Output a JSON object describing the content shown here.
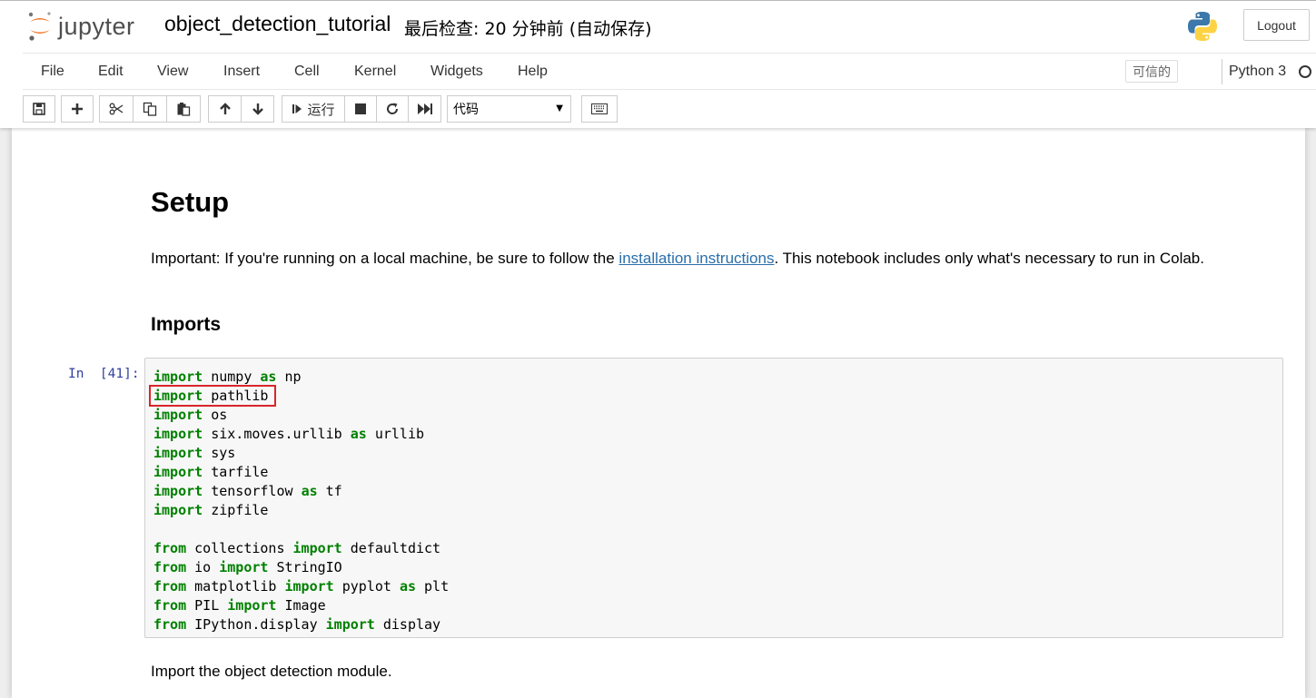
{
  "header": {
    "logo_text": "jupyter",
    "notebook_name": "object_detection_tutorial",
    "save_status": "最后检查: 20 分钟前  (自动保存)",
    "logout_label": "Logout"
  },
  "menu": {
    "items": [
      "File",
      "Edit",
      "View",
      "Insert",
      "Cell",
      "Kernel",
      "Widgets",
      "Help"
    ],
    "trusted_label": "可信的",
    "kernel_name": "Python 3"
  },
  "toolbar": {
    "run_label": "运行",
    "cell_type": "代码",
    "icons": [
      "save-icon",
      "plus-icon",
      "cut-icon",
      "copy-icon",
      "paste-icon",
      "arrow-up-icon",
      "arrow-down-icon",
      "run-icon",
      "stop-icon",
      "restart-icon",
      "fast-forward-icon",
      "keyboard-icon"
    ]
  },
  "notebook": {
    "heading_setup": "Setup",
    "important_text_before": "Important: If you're running on a local machine, be sure to follow the ",
    "important_link": "installation instructions",
    "important_text_after": ". This notebook includes only what's necessary to run in Colab.",
    "heading_imports": "Imports",
    "prompt": "In  [41]:",
    "code_lines": [
      [
        {
          "k": "import"
        },
        {
          "t": " numpy "
        },
        {
          "k": "as"
        },
        {
          "t": " np"
        }
      ],
      [
        {
          "k": "import"
        },
        {
          "t": " pathlib"
        }
      ],
      [
        {
          "k": "import"
        },
        {
          "t": " os"
        }
      ],
      [
        {
          "k": "import"
        },
        {
          "t": " six.moves.urllib "
        },
        {
          "k": "as"
        },
        {
          "t": " urllib"
        }
      ],
      [
        {
          "k": "import"
        },
        {
          "t": " sys"
        }
      ],
      [
        {
          "k": "import"
        },
        {
          "t": " tarfile"
        }
      ],
      [
        {
          "k": "import"
        },
        {
          "t": " tensorflow "
        },
        {
          "k": "as"
        },
        {
          "t": " tf"
        }
      ],
      [
        {
          "k": "import"
        },
        {
          "t": " zipfile"
        }
      ],
      [],
      [
        {
          "k": "from"
        },
        {
          "t": " collections "
        },
        {
          "k": "import"
        },
        {
          "t": " defaultdict"
        }
      ],
      [
        {
          "k": "from"
        },
        {
          "t": " io "
        },
        {
          "k": "import"
        },
        {
          "t": " StringIO"
        }
      ],
      [
        {
          "k": "from"
        },
        {
          "t": " matplotlib "
        },
        {
          "k": "import"
        },
        {
          "t": " pyplot "
        },
        {
          "k": "as"
        },
        {
          "t": " plt"
        }
      ],
      [
        {
          "k": "from"
        },
        {
          "t": " PIL "
        },
        {
          "k": "import"
        },
        {
          "t": " Image"
        }
      ],
      [
        {
          "k": "from"
        },
        {
          "t": " IPython.display "
        },
        {
          "k": "import"
        },
        {
          "t": " display"
        }
      ]
    ],
    "detection_text": "Import the object detection module."
  },
  "colors": {
    "keyword": "#008000",
    "link": "#296eaa",
    "prompt": "#303f9f",
    "highlight_box": "#d9252a"
  }
}
